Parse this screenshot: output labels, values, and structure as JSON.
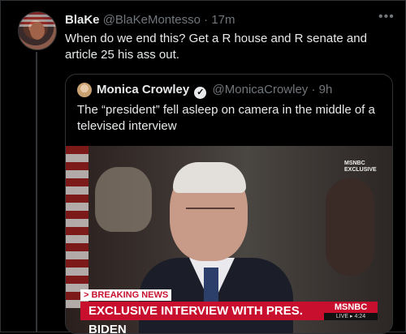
{
  "tweet": {
    "name": "BlaKe",
    "handle": "@BlaKeMontesso",
    "separator": "·",
    "time": "17m",
    "more_icon": "more-horizontal-icon",
    "text": "When do we end this? Get a R house and R senate and article 25 his ass out."
  },
  "quote": {
    "name": "Monica Crowley",
    "verified_icon": "verified-check-icon",
    "handle": "@MonicaCrowley",
    "separator": "·",
    "time": "9h",
    "text": "The “president” fell asleep on camera in the middle of a televised interview"
  },
  "video": {
    "corner_logo": "MSNBC",
    "corner_logo_sub": "EXCLUSIVE",
    "breaking": "> BREAKING NEWS",
    "headline": "EXCLUSIVE INTERVIEW WITH PRES. BIDEN",
    "network": "MSNBC",
    "live": "LIVE ▸ 4:24"
  },
  "colors": {
    "background": "#000000",
    "text": "#e7e9ea",
    "muted": "#71767b",
    "border": "#2f3336",
    "news_red": "#c8102e"
  }
}
